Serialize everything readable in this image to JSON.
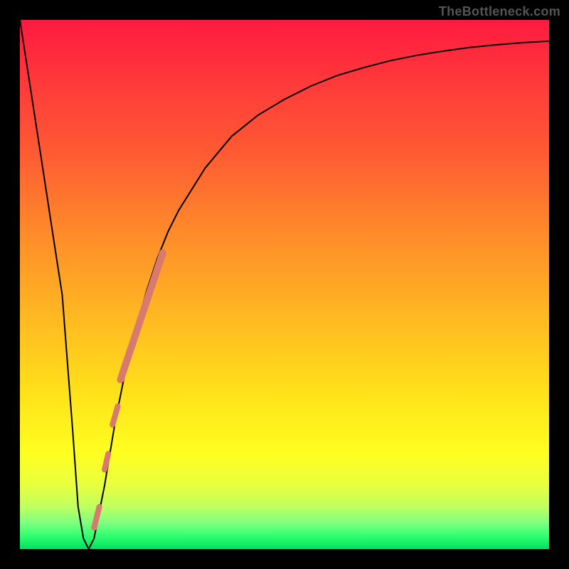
{
  "watermark": "TheBottleneck.com",
  "chart_data": {
    "type": "line",
    "title": "",
    "xlabel": "",
    "ylabel": "",
    "xlim": [
      0,
      100
    ],
    "ylim": [
      0,
      100
    ],
    "x": [
      0,
      2,
      4,
      6,
      8,
      10,
      11,
      12,
      13,
      14,
      16,
      18,
      20,
      22,
      24,
      26,
      28,
      30,
      35,
      40,
      45,
      50,
      55,
      60,
      65,
      70,
      75,
      80,
      85,
      90,
      95,
      100
    ],
    "values": [
      100,
      87,
      74,
      61,
      48,
      22,
      8,
      2,
      0,
      2,
      12,
      24,
      34,
      42,
      49,
      55,
      60,
      64,
      72,
      78,
      82,
      85,
      87.5,
      89.5,
      91,
      92.3,
      93.3,
      94.1,
      94.8,
      95.3,
      95.7,
      96
    ],
    "gradient_stops": [
      {
        "pos": 0,
        "color": "#ff1a40"
      },
      {
        "pos": 12,
        "color": "#ff3a3a"
      },
      {
        "pos": 25,
        "color": "#ff5a33"
      },
      {
        "pos": 40,
        "color": "#ff8a2a"
      },
      {
        "pos": 55,
        "color": "#ffb522"
      },
      {
        "pos": 70,
        "color": "#ffe01a"
      },
      {
        "pos": 82,
        "color": "#ffff20"
      },
      {
        "pos": 88,
        "color": "#e8ff40"
      },
      {
        "pos": 92,
        "color": "#c0ff60"
      },
      {
        "pos": 95,
        "color": "#80ff80"
      },
      {
        "pos": 97.5,
        "color": "#30ff70"
      },
      {
        "pos": 100,
        "color": "#00e060"
      }
    ],
    "markers": [
      {
        "x1": 19,
        "y1": 32,
        "x2": 27,
        "y2": 56,
        "width": 10
      },
      {
        "x1": 17.5,
        "y1": 23.5,
        "x2": 18.5,
        "y2": 27,
        "width": 8
      },
      {
        "x1": 16,
        "y1": 15,
        "x2": 16.7,
        "y2": 18,
        "width": 8
      },
      {
        "x1": 14,
        "y1": 4,
        "x2": 15,
        "y2": 8,
        "width": 8
      }
    ],
    "marker_color": "#d97a6e"
  }
}
